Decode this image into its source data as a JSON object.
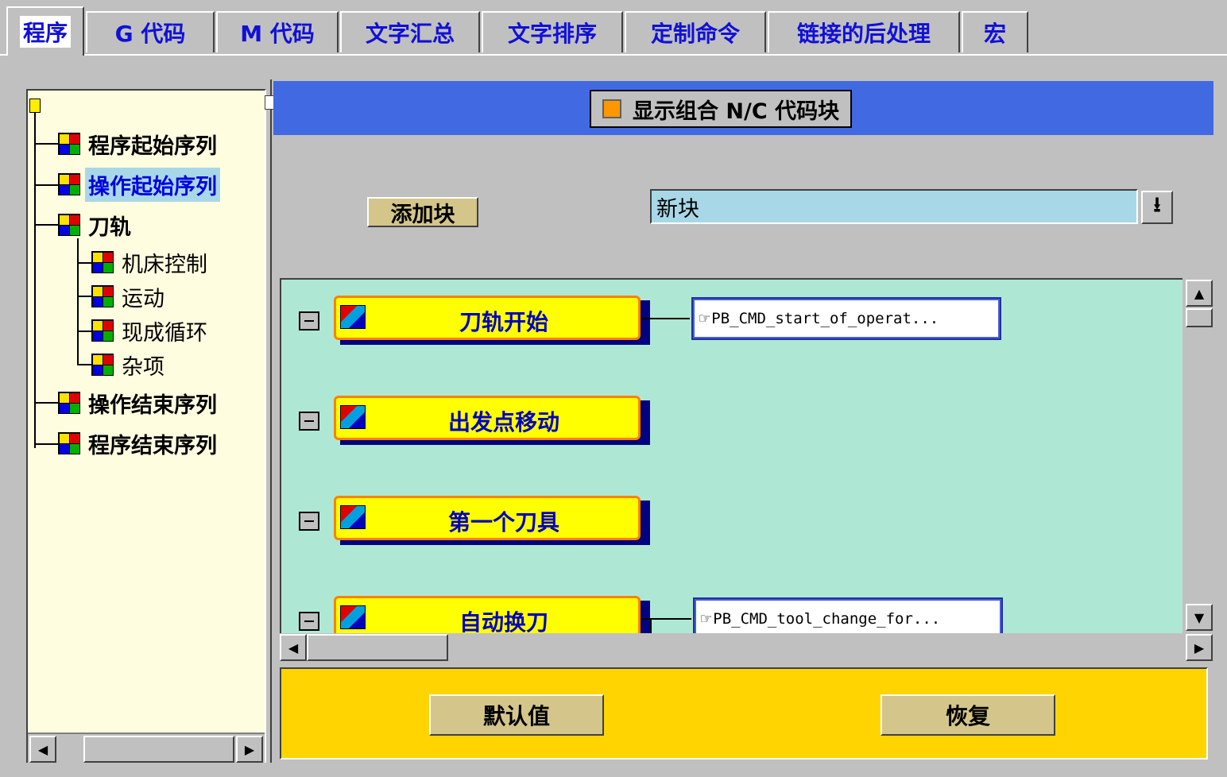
{
  "tabs": [
    {
      "label": "程序",
      "active": true
    },
    {
      "label": "G 代码",
      "active": false
    },
    {
      "label": "M 代码",
      "active": false
    },
    {
      "label": "文字汇总",
      "active": false
    },
    {
      "label": "文字排序",
      "active": false
    },
    {
      "label": "定制命令",
      "active": false
    },
    {
      "label": "链接的后处理",
      "active": false
    },
    {
      "label": "宏",
      "active": false
    }
  ],
  "tree": {
    "items": [
      {
        "label": "程序起始序列"
      },
      {
        "label": "操作起始序列",
        "selected": true
      },
      {
        "label": "刀轨"
      },
      {
        "label": "机床控制"
      },
      {
        "label": "运动"
      },
      {
        "label": "现成循环"
      },
      {
        "label": "杂项"
      },
      {
        "label": "操作结束序列"
      },
      {
        "label": "程序结束序列"
      }
    ]
  },
  "header": {
    "combined_checkbox_label": "显示组合 N/C 代码块"
  },
  "add_block": {
    "button_label": "添加块",
    "input_value": "新块",
    "dropdown_glyph": "⭳"
  },
  "canvas": {
    "markers": [
      {
        "label": "刀轨开始",
        "command": "PB_CMD_start_of_operat..."
      },
      {
        "label": "出发点移动",
        "command": ""
      },
      {
        "label": "第一个刀具",
        "command": ""
      },
      {
        "label": "自动换刀",
        "command": "PB_CMD_tool_change_for..."
      }
    ]
  },
  "footer": {
    "default_label": "默认值",
    "restore_label": "恢复"
  },
  "colors": {
    "tab_text": "#1010d8",
    "header_blue": "#4169e1",
    "canvas_bg": "#aee8d4",
    "marker_fill": "#ffff00",
    "footer_bg": "#ffd400"
  }
}
